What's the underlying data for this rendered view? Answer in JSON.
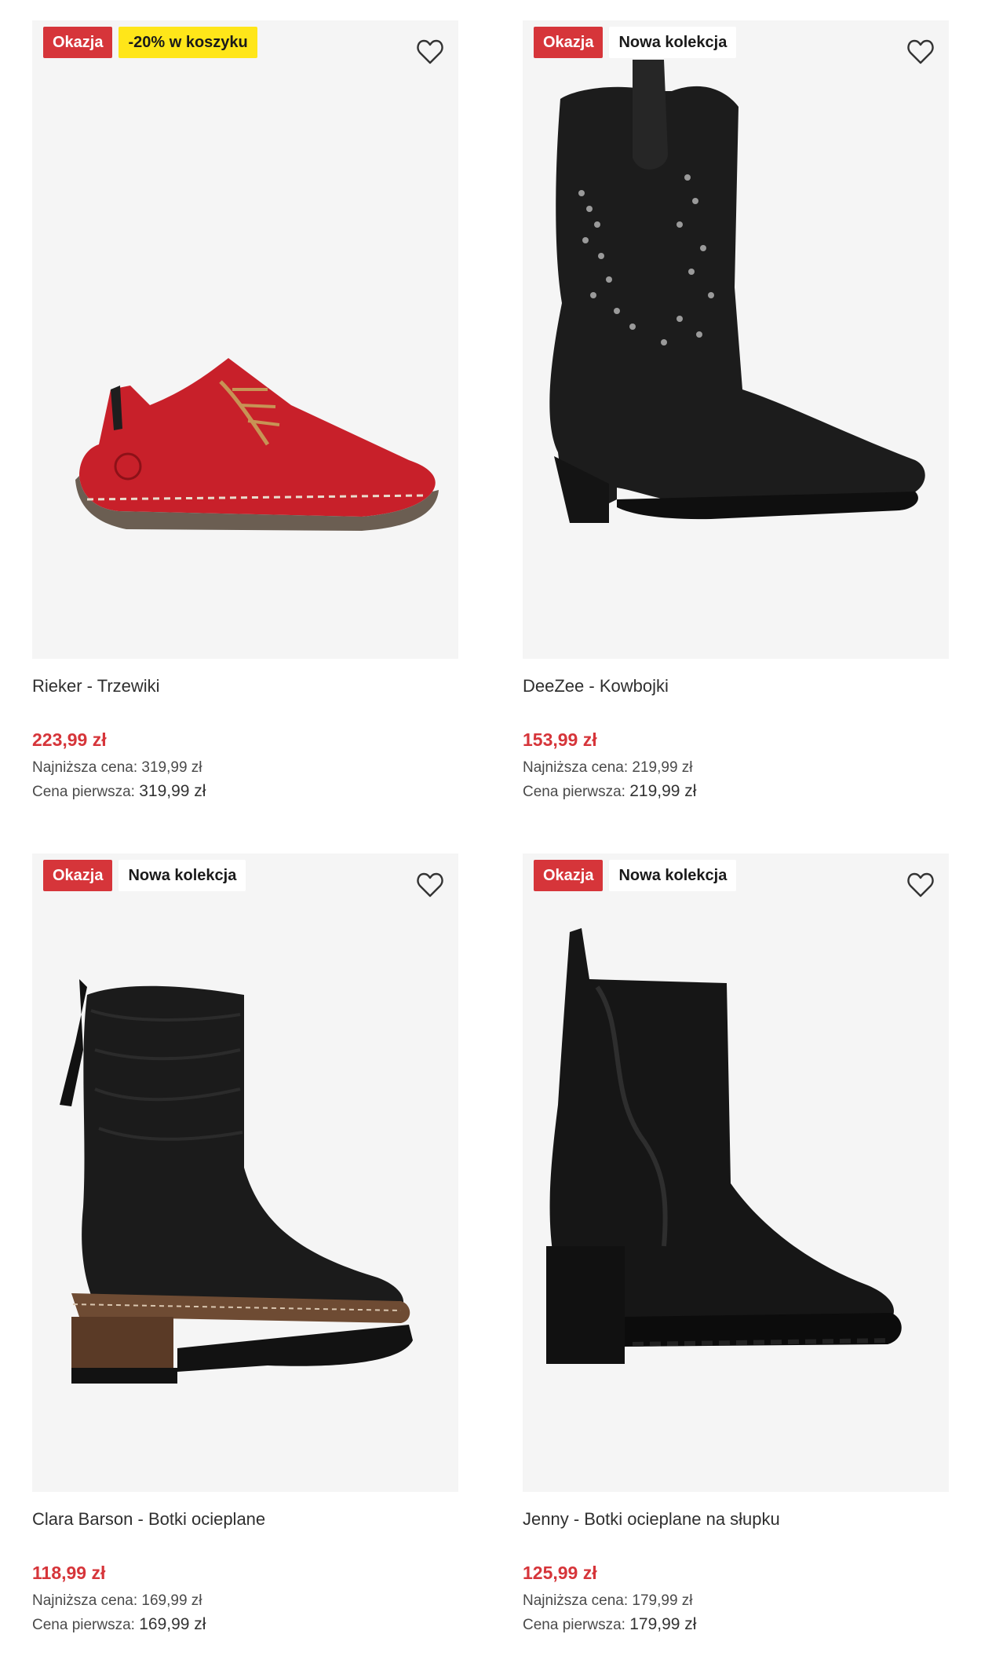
{
  "products": [
    {
      "badges": [
        "Okazja",
        "-20% w koszyku"
      ],
      "title": "Rieker - Trzewiki",
      "price": "223,99 zł",
      "lowest_label": "Najniższa cena:",
      "lowest_value": "319,99 zł",
      "first_label": "Cena pierwsza:",
      "first_value": "319,99 zł"
    },
    {
      "badges": [
        "Okazja",
        "Nowa kolekcja"
      ],
      "title": "DeeZee - Kowbojki",
      "price": "153,99 zł",
      "lowest_label": "Najniższa cena:",
      "lowest_value": "219,99 zł",
      "first_label": "Cena pierwsza:",
      "first_value": "219,99 zł"
    },
    {
      "badges": [
        "Okazja",
        "Nowa kolekcja"
      ],
      "title": "Clara Barson - Botki ocieplane",
      "price": "118,99 zł",
      "lowest_label": "Najniższa cena:",
      "lowest_value": "169,99 zł",
      "first_label": "Cena pierwsza:",
      "first_value": "169,99 zł"
    },
    {
      "badges": [
        "Okazja",
        "Nowa kolekcja"
      ],
      "title": "Jenny - Botki ocieplane na słupku",
      "price": "125,99 zł",
      "lowest_label": "Najniższa cena:",
      "lowest_value": "179,99 zł",
      "first_label": "Cena pierwsza:",
      "first_value": "179,99 zł"
    }
  ],
  "colors": {
    "sale_red": "#d6353a",
    "promo_yellow": "#ffe619",
    "card_bg": "#f5f5f5"
  },
  "icons": {
    "wishlist": "heart-outline-icon"
  }
}
